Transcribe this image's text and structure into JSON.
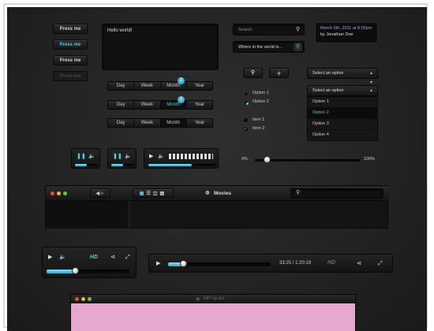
{
  "buttons": {
    "b1": "Press me",
    "b2": "Press me",
    "b3": "Press me",
    "b4": "Press me"
  },
  "textarea": {
    "value": "Hello world!"
  },
  "search": {
    "placeholder": "Search"
  },
  "location": {
    "value": "Where in the world is..."
  },
  "tooltip": {
    "line1": "March 6th, 2011 at 8:02pm",
    "line2": "by Jonathan Doe"
  },
  "segmented": [
    {
      "items": [
        "Day",
        "Week",
        "Month",
        "Year"
      ],
      "active": -1,
      "badge": ""
    },
    {
      "items": [
        "Day",
        "Week",
        "Month",
        "Year"
      ],
      "active": 2,
      "badge": "2"
    },
    {
      "items": [
        "Day",
        "Week",
        "Month",
        "Year"
      ],
      "active": -1,
      "badge": ""
    }
  ],
  "segBadges": {
    "row1": "2",
    "row2": "2"
  },
  "radios": [
    {
      "label": "Option 1",
      "checked": false
    },
    {
      "label": "Option 2",
      "checked": true
    }
  ],
  "checks": [
    {
      "label": "Item 1",
      "checked": false
    },
    {
      "label": "Item 2",
      "checked": true
    }
  ],
  "select1": {
    "value": "Select an option"
  },
  "select2": {
    "value": "Select an option",
    "options": [
      "Option 1",
      "Option 2",
      "Option 3",
      "Option 4"
    ],
    "highlighted": 1
  },
  "slider": {
    "min_label": "0%",
    "max_label": "100%",
    "value": 0.12
  },
  "mini_players": {
    "p1_progress": 0.5,
    "p2_progress": 0.5,
    "p3_progress": 0.65
  },
  "browser": {
    "title": "Movies",
    "search_placeholder": ""
  },
  "video_player_small": {
    "hd": "HD",
    "progress": 0.35
  },
  "video_player_large": {
    "time": "33:25 / 1:20:19",
    "hd": "HD",
    "progress": 0.15
  },
  "bottom_window": {
    "title": "MrFuji.avi"
  },
  "colors": {
    "accent": "#4ec9e6",
    "bg": "#222222",
    "pink": "#e7a8d0"
  }
}
